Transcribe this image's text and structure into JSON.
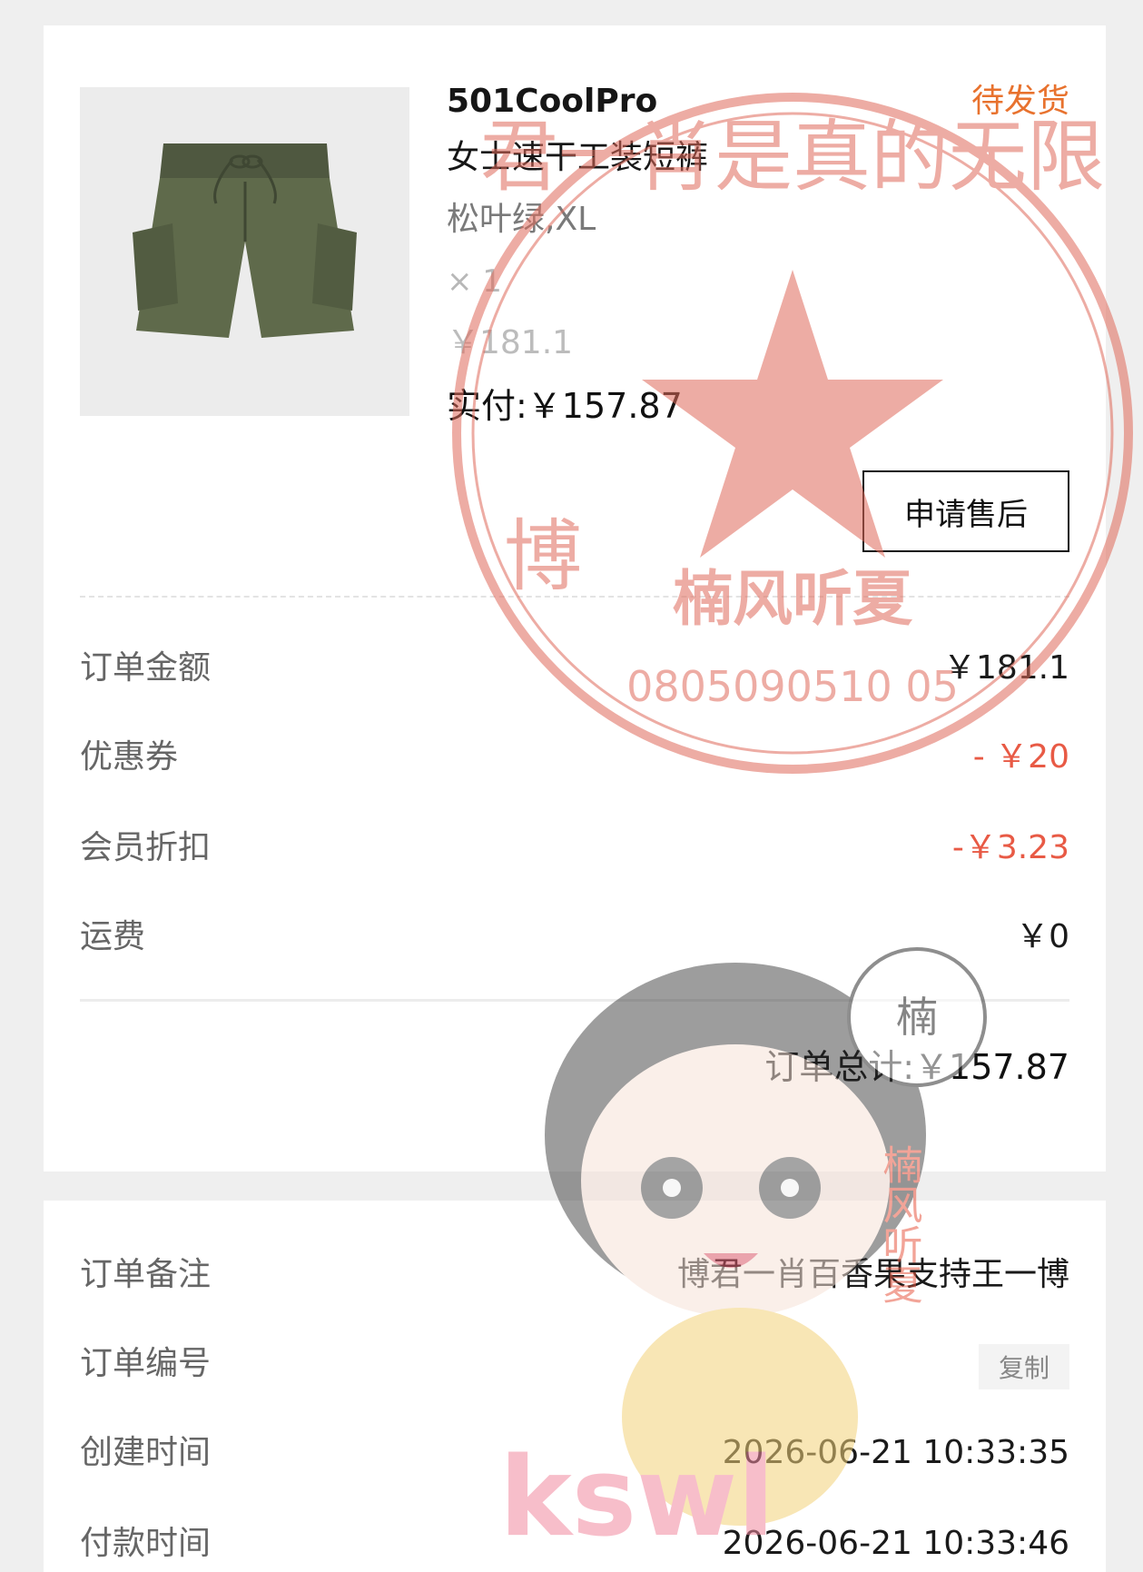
{
  "product": {
    "name_line1": "501CoolPro",
    "name_line2": "女士速干工装短裤",
    "status": "待发货",
    "spec": "松叶绿,XL",
    "quantity": "× 1",
    "original_price": "￥181.1",
    "paid": "实付:￥157.87",
    "after_sale_button": "申请售后",
    "image_icon": "shorts-image"
  },
  "summary": {
    "rows": [
      {
        "label": "订单金额",
        "value": "￥181.1"
      },
      {
        "label": "优惠券",
        "value": "- ￥20"
      },
      {
        "label": "会员折扣",
        "value": "-￥3.23"
      },
      {
        "label": "运费",
        "value": "￥0"
      }
    ],
    "total": "订单总计:￥157.87"
  },
  "info": {
    "rows": [
      {
        "label": "订单备注",
        "value": "博君一肖百香果支持王一博"
      },
      {
        "label": "订单编号",
        "value": ""
      },
      {
        "label": "创建时间",
        "value": "2026-06-21 10:33:35"
      },
      {
        "label": "付款时间",
        "value": "2026-06-21 10:33:46"
      }
    ],
    "copy_button": "复制"
  },
  "stamp": {
    "top_text": "君一肖是真的无限",
    "left_char": "博",
    "center_text": "楠风听夏",
    "number": "0805090510 05"
  },
  "watermark": {
    "logo_text": "kswl",
    "side_text": "楠风听夏",
    "seal_char": "楠"
  },
  "colors": {
    "status": "#e8722e",
    "discount": "#e85a45",
    "stamp": "#e06a5a"
  }
}
